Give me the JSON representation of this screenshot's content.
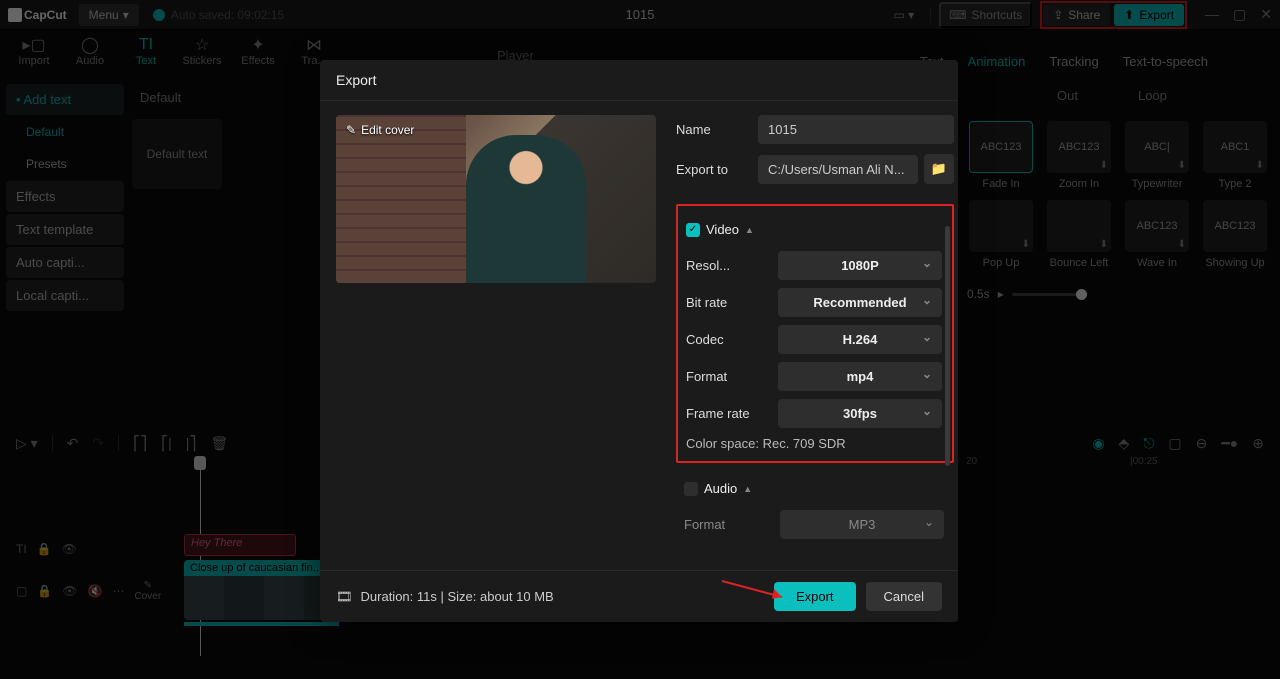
{
  "app": {
    "name": "CapCut",
    "menu": "Menu",
    "autosave": "Auto saved: 09:02:15",
    "title": "1015"
  },
  "topbar": {
    "shortcuts": "Shortcuts",
    "share": "Share",
    "export": "Export"
  },
  "tooltabs": {
    "import": "Import",
    "audio": "Audio",
    "text": "Text",
    "stickers": "Stickers",
    "effects": "Effects",
    "transitions": "Tra..."
  },
  "sidebar": {
    "addtext": "Add text",
    "default": "Default",
    "presets": "Presets",
    "effects": "Effects",
    "template": "Text template",
    "autoc": "Auto capti...",
    "localc": "Local capti..."
  },
  "texts": {
    "head": "Default",
    "card": "Default text"
  },
  "player": "Player",
  "righttabs": {
    "text": "Text",
    "animation": "Animation",
    "tracking": "Tracking",
    "tts": "Text-to-speech"
  },
  "animtabs": {
    "out": "Out",
    "loop": "Loop"
  },
  "anims": {
    "r1": [
      "Fade In",
      "Zoom In",
      "Typewriter",
      "Type 2"
    ],
    "r2": [
      "Pop Up",
      "Bounce Left",
      "Wave In",
      "Showing Up"
    ],
    "thumbs": [
      "ABC123",
      "ABC123",
      "ABC|",
      "ABC1",
      "",
      "",
      "ABC123",
      "ABC123"
    ]
  },
  "duration": "0.5s",
  "ruler": {
    "t20": "20",
    "t25": "|00:25"
  },
  "clips": {
    "text": "Hey There",
    "video": "Close up of caucasian fin...",
    "cover": "Cover"
  },
  "modal": {
    "title": "Export",
    "editcover": "Edit cover",
    "name_lbl": "Name",
    "name_val": "1015",
    "exportto_lbl": "Export to",
    "exportto_val": "C:/Users/Usman Ali N...",
    "video": "Video",
    "resolution_lbl": "Resol...",
    "resolution_val": "1080P",
    "bitrate_lbl": "Bit rate",
    "bitrate_val": "Recommended",
    "codec_lbl": "Codec",
    "codec_val": "H.264",
    "format_lbl": "Format",
    "format_val": "mp4",
    "framerate_lbl": "Frame rate",
    "framerate_val": "30fps",
    "colorspace": "Color space: Rec. 709 SDR",
    "audio": "Audio",
    "aformat_lbl": "Format",
    "aformat_val": "MP3",
    "footinfo": "Duration: 11s | Size: about 10 MB",
    "export_btn": "Export",
    "cancel_btn": "Cancel"
  }
}
